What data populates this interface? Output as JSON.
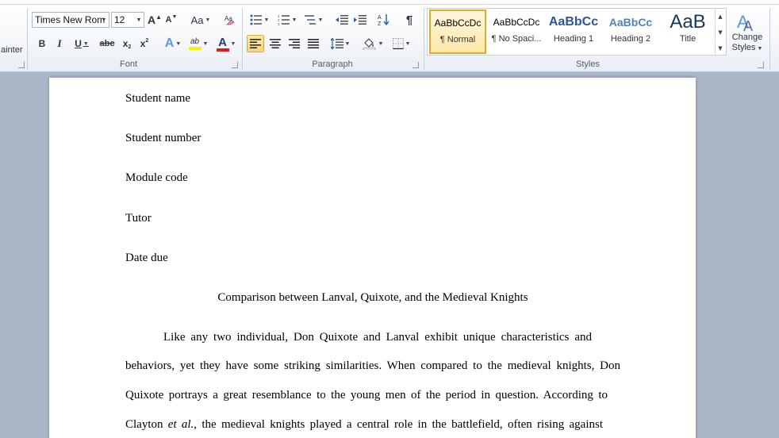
{
  "ribbon": {
    "clipboard": {
      "painter_label": "ainter"
    },
    "font": {
      "group_label": "Font",
      "font_name": "Times New Rom",
      "font_size": "12",
      "grow_label": "A",
      "shrink_label": "A",
      "change_case_label": "Aa",
      "bold": "B",
      "italic": "I",
      "underline": "U",
      "strike": "abc",
      "subscript": "x",
      "superscript": "x",
      "text_effects": "A",
      "highlight": "ab",
      "font_color": "A",
      "font_color_value": "#e01a1a",
      "highlight_color_value": "#fff200"
    },
    "paragraph": {
      "group_label": "Paragraph",
      "pilcrow": "¶"
    },
    "styles": {
      "group_label": "Styles",
      "items": [
        {
          "sample": "AaBbCcDc",
          "name": "¶ Normal"
        },
        {
          "sample": "AaBbCcDc",
          "name": "¶ No Spaci..."
        },
        {
          "sample": "AaBbCc",
          "name": "Heading 1"
        },
        {
          "sample": "AaBbCc",
          "name": "Heading 2"
        },
        {
          "sample": "AaB",
          "name": "Title"
        }
      ],
      "change_styles_line1": "Change",
      "change_styles_line2": "Styles"
    }
  },
  "document": {
    "lines": [
      "Student name",
      "Student number",
      "Module code",
      "Tutor",
      "Date due"
    ],
    "title": "Comparison between Lanval, Quixote, and the Medieval Knights",
    "paragraph": {
      "line1": "Like any two individual, Don Quixote and Lanval exhibit unique characteristics  and",
      "line2": "behaviors, yet they have some striking similarities.  When compared to the medieval knights, Don",
      "line3": "Quixote portrays a great resemblance  to the young men  of the period in question.  According to",
      "line4_a": "Clayton ",
      "line4_em": "et al.,",
      "line4_b": "  the medieval knights played a central role in the battlefield, often rising  against"
    }
  }
}
